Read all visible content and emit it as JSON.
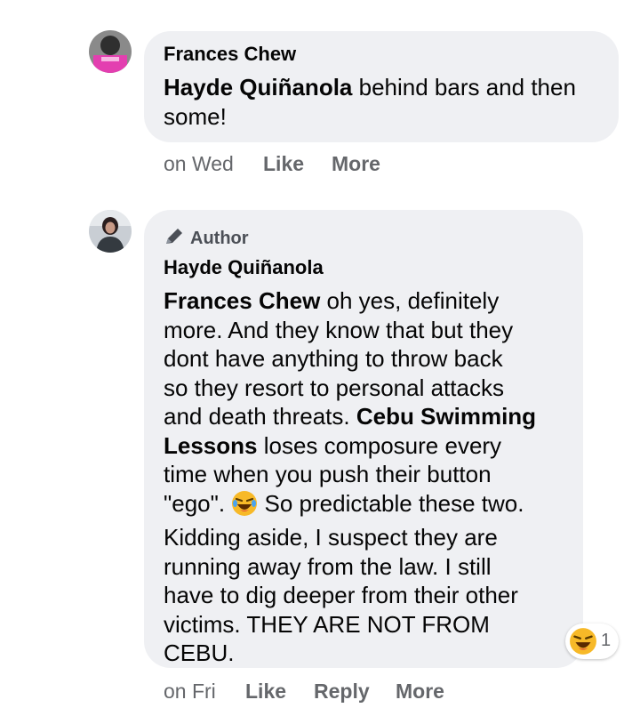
{
  "comments": [
    {
      "author": "Frances Chew",
      "mention": "Hayde Quiñanola",
      "text_lines": [
        " behind bars and then",
        "some!"
      ],
      "time": "on Wed",
      "actions": [
        "Like",
        "More"
      ]
    },
    {
      "badge": "Author",
      "author": "Hayde Quiñanola",
      "mention_1": "Frances Chew",
      "line_1_rest": " oh yes, definitely",
      "line_2": "more. And they know that but they",
      "line_3": "dont have anything to throw back",
      "line_4": "so they resort to personal attacks",
      "line_5_pre": "and death threats. ",
      "mention_2a": "Cebu Swimming",
      "mention_2b": "Lessons",
      "line_6_rest": " loses composure every",
      "line_7": "time when you push their button",
      "line_8_pre": "\"ego\". ",
      "line_8_post": " So predictable these two.",
      "line_9": "Kidding aside, I suspect they are",
      "line_10": "running away from the law. I still",
      "line_11": "have to dig deeper from their other",
      "line_12": "victims. THEY ARE NOT FROM",
      "line_13": "CEBU.",
      "reaction_icon": "laughing-tears-emoji",
      "reaction_count": "1",
      "time": "on Fri",
      "actions": [
        "Like",
        "Reply",
        "More"
      ]
    }
  ],
  "colors": {
    "bubble": "#eff0f3",
    "meta": "#65676b",
    "text": "#050505"
  }
}
